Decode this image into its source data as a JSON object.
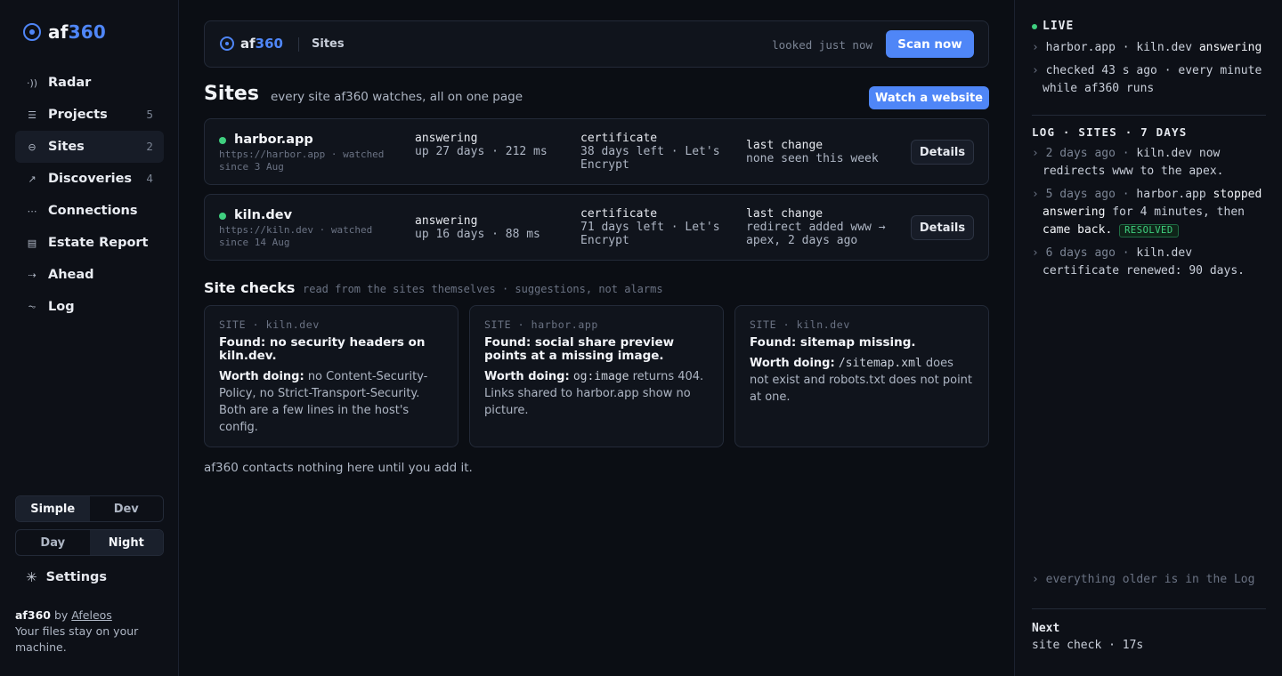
{
  "brand": {
    "name_a": "af",
    "name_b": "360",
    "accent": "#4f86f7"
  },
  "nav": [
    {
      "icon": "radar-icon",
      "glyph": "·))",
      "label": "Radar",
      "count": ""
    },
    {
      "icon": "projects-icon",
      "glyph": "☰",
      "label": "Projects",
      "count": "5"
    },
    {
      "icon": "sites-icon",
      "glyph": "⊖",
      "label": "Sites",
      "count": "2",
      "active": true
    },
    {
      "icon": "discoveries-icon",
      "glyph": "↗",
      "label": "Discoveries",
      "count": "4"
    },
    {
      "icon": "connections-icon",
      "glyph": "⋯",
      "label": "Connections",
      "count": ""
    },
    {
      "icon": "estate-report-icon",
      "glyph": "▤",
      "label": "Estate Report",
      "count": ""
    },
    {
      "icon": "ahead-icon",
      "glyph": "⇢",
      "label": "Ahead",
      "count": ""
    },
    {
      "icon": "log-icon",
      "glyph": "⏦",
      "label": "Log",
      "count": ""
    }
  ],
  "mode": {
    "simple": "Simple",
    "dev": "Dev"
  },
  "theme": {
    "day": "Day",
    "night": "Night"
  },
  "settings": "Settings",
  "credit": {
    "brand_a": "af",
    "brand_b": "360",
    "by": "by",
    "author": "Afeleos",
    "line2": "Your files stay on your machine."
  },
  "topbar": {
    "brand_a": "af",
    "brand_b": "360",
    "crumb": "Sites",
    "looked": "looked just now",
    "scan": "Scan now"
  },
  "page": {
    "title": "Sites",
    "subtitle": "every site af360 watches, all on one page",
    "watch": "Watch a website"
  },
  "sites": [
    {
      "name": "harbor.app",
      "meta": "https://harbor.app · watched since 3 Aug",
      "status_k": "answering",
      "status_v": "up 27 days · 212 ms",
      "cert_k": "certificate",
      "cert_v": "38 days left · Let's Encrypt",
      "change_k": "last change",
      "change_v": "none seen this week",
      "details": "Details"
    },
    {
      "name": "kiln.dev",
      "meta": "https://kiln.dev · watched since 14 Aug",
      "status_k": "answering",
      "status_v": "up 16 days · 88 ms",
      "cert_k": "certificate",
      "cert_v": "71 days left · Let's Encrypt",
      "change_k": "last change",
      "change_v": "redirect added www → apex, 2 days ago",
      "details": "Details"
    }
  ],
  "checks": {
    "title": "Site checks",
    "subtitle": "read from the sites themselves · suggestions, not alarms",
    "cards": [
      {
        "tag": "SITE · kiln.dev",
        "found": "Found: no security headers on kiln.dev.",
        "worth": "Worth doing:",
        "body": "no Content-Security-Policy, no Strict-Transport-Security. Both are a few lines in the host's config."
      },
      {
        "tag": "SITE · harbor.app",
        "found": "Found: social share preview points at a missing image.",
        "worth": "Worth doing:",
        "code": "og:image",
        "body": "returns 404. Links shared to harbor.app show no picture."
      },
      {
        "tag": "SITE · kiln.dev",
        "found": "Found: sitemap missing.",
        "worth": "Worth doing:",
        "code": "/sitemap.xml",
        "body": "does not exist and robots.txt does not point at one."
      }
    ]
  },
  "footer_note": "af360 contacts nothing here until you add it.",
  "live": {
    "title": "LIVE",
    "l1_sites": "harbor.app · kiln.dev",
    "l1_status": "answering",
    "l2": "checked 43 s ago · every minute while af360 runs"
  },
  "log": {
    "title": "LOG · SITES · 7 DAYS",
    "entries": [
      {
        "when": "2 days ago",
        "sep": "·",
        "text": "kiln.dev now redirects www to the apex."
      },
      {
        "when": "5 days ago",
        "sep": "·",
        "site": "harbor.app",
        "hl1": "stopped answering",
        "mid": "for 4 minutes, then",
        "hl2": "came back.",
        "badge": "RESOLVED"
      },
      {
        "when": "6 days ago",
        "sep": "·",
        "text": "kiln.dev certificate renewed: 90 days."
      }
    ],
    "older": "everything older is in the Log"
  },
  "next": {
    "title": "Next",
    "value": "site check · 17s"
  }
}
